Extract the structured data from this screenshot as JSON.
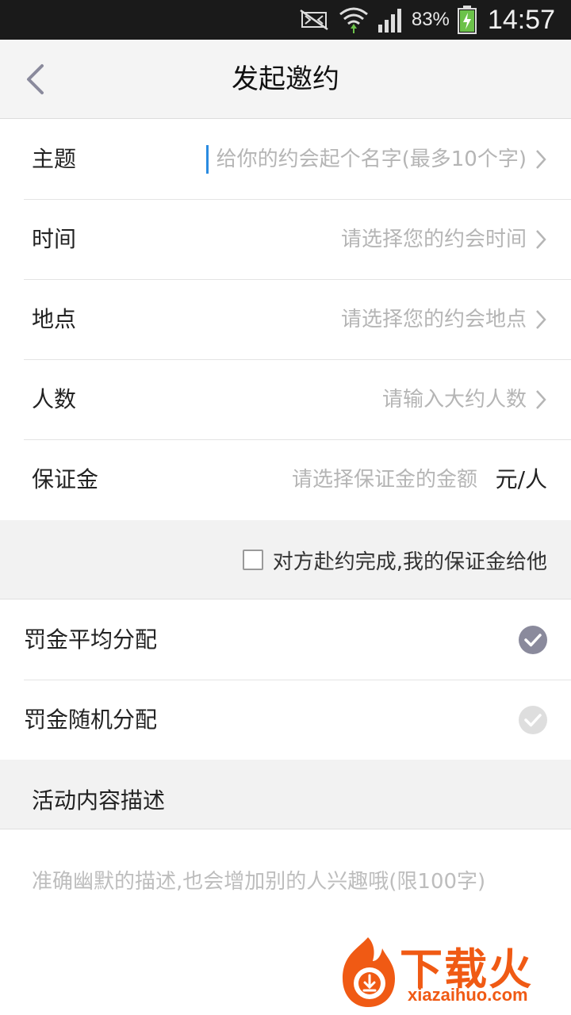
{
  "status_bar": {
    "battery_percent": "83%",
    "time": "14:57",
    "icons": [
      "mute-icon",
      "wifi-icon",
      "signal-icon",
      "battery-icon"
    ]
  },
  "header": {
    "title": "发起邀约",
    "back_icon": "chevron-left-icon"
  },
  "form": {
    "rows": [
      {
        "label": "主题",
        "placeholder": "给你的约会起个名字(最多10个字)"
      },
      {
        "label": "时间",
        "placeholder": "请选择您的约会时间"
      },
      {
        "label": "地点",
        "placeholder": "请选择您的约会地点"
      },
      {
        "label": "人数",
        "placeholder": "请输入大约人数"
      },
      {
        "label": "保证金",
        "placeholder": "请选择保证金的金额",
        "unit": "元/人"
      }
    ]
  },
  "deposit_option": {
    "label": "对方赴约完成,我的保证金给他",
    "checked": false
  },
  "penalty": {
    "options": [
      {
        "label": "罚金平均分配",
        "selected": true
      },
      {
        "label": "罚金随机分配",
        "selected": false
      }
    ]
  },
  "description": {
    "section_title": "活动内容描述",
    "placeholder": "准确幽默的描述,也会增加别的人兴趣哦(限100字)"
  },
  "watermark": {
    "brand": "下载火",
    "url": "xiazaihuo.com"
  },
  "colors": {
    "accent_caret": "#2a8be0",
    "check_selected": "#8a8a9c",
    "check_unselected": "#d9d9d9",
    "watermark": "#f05a14"
  }
}
